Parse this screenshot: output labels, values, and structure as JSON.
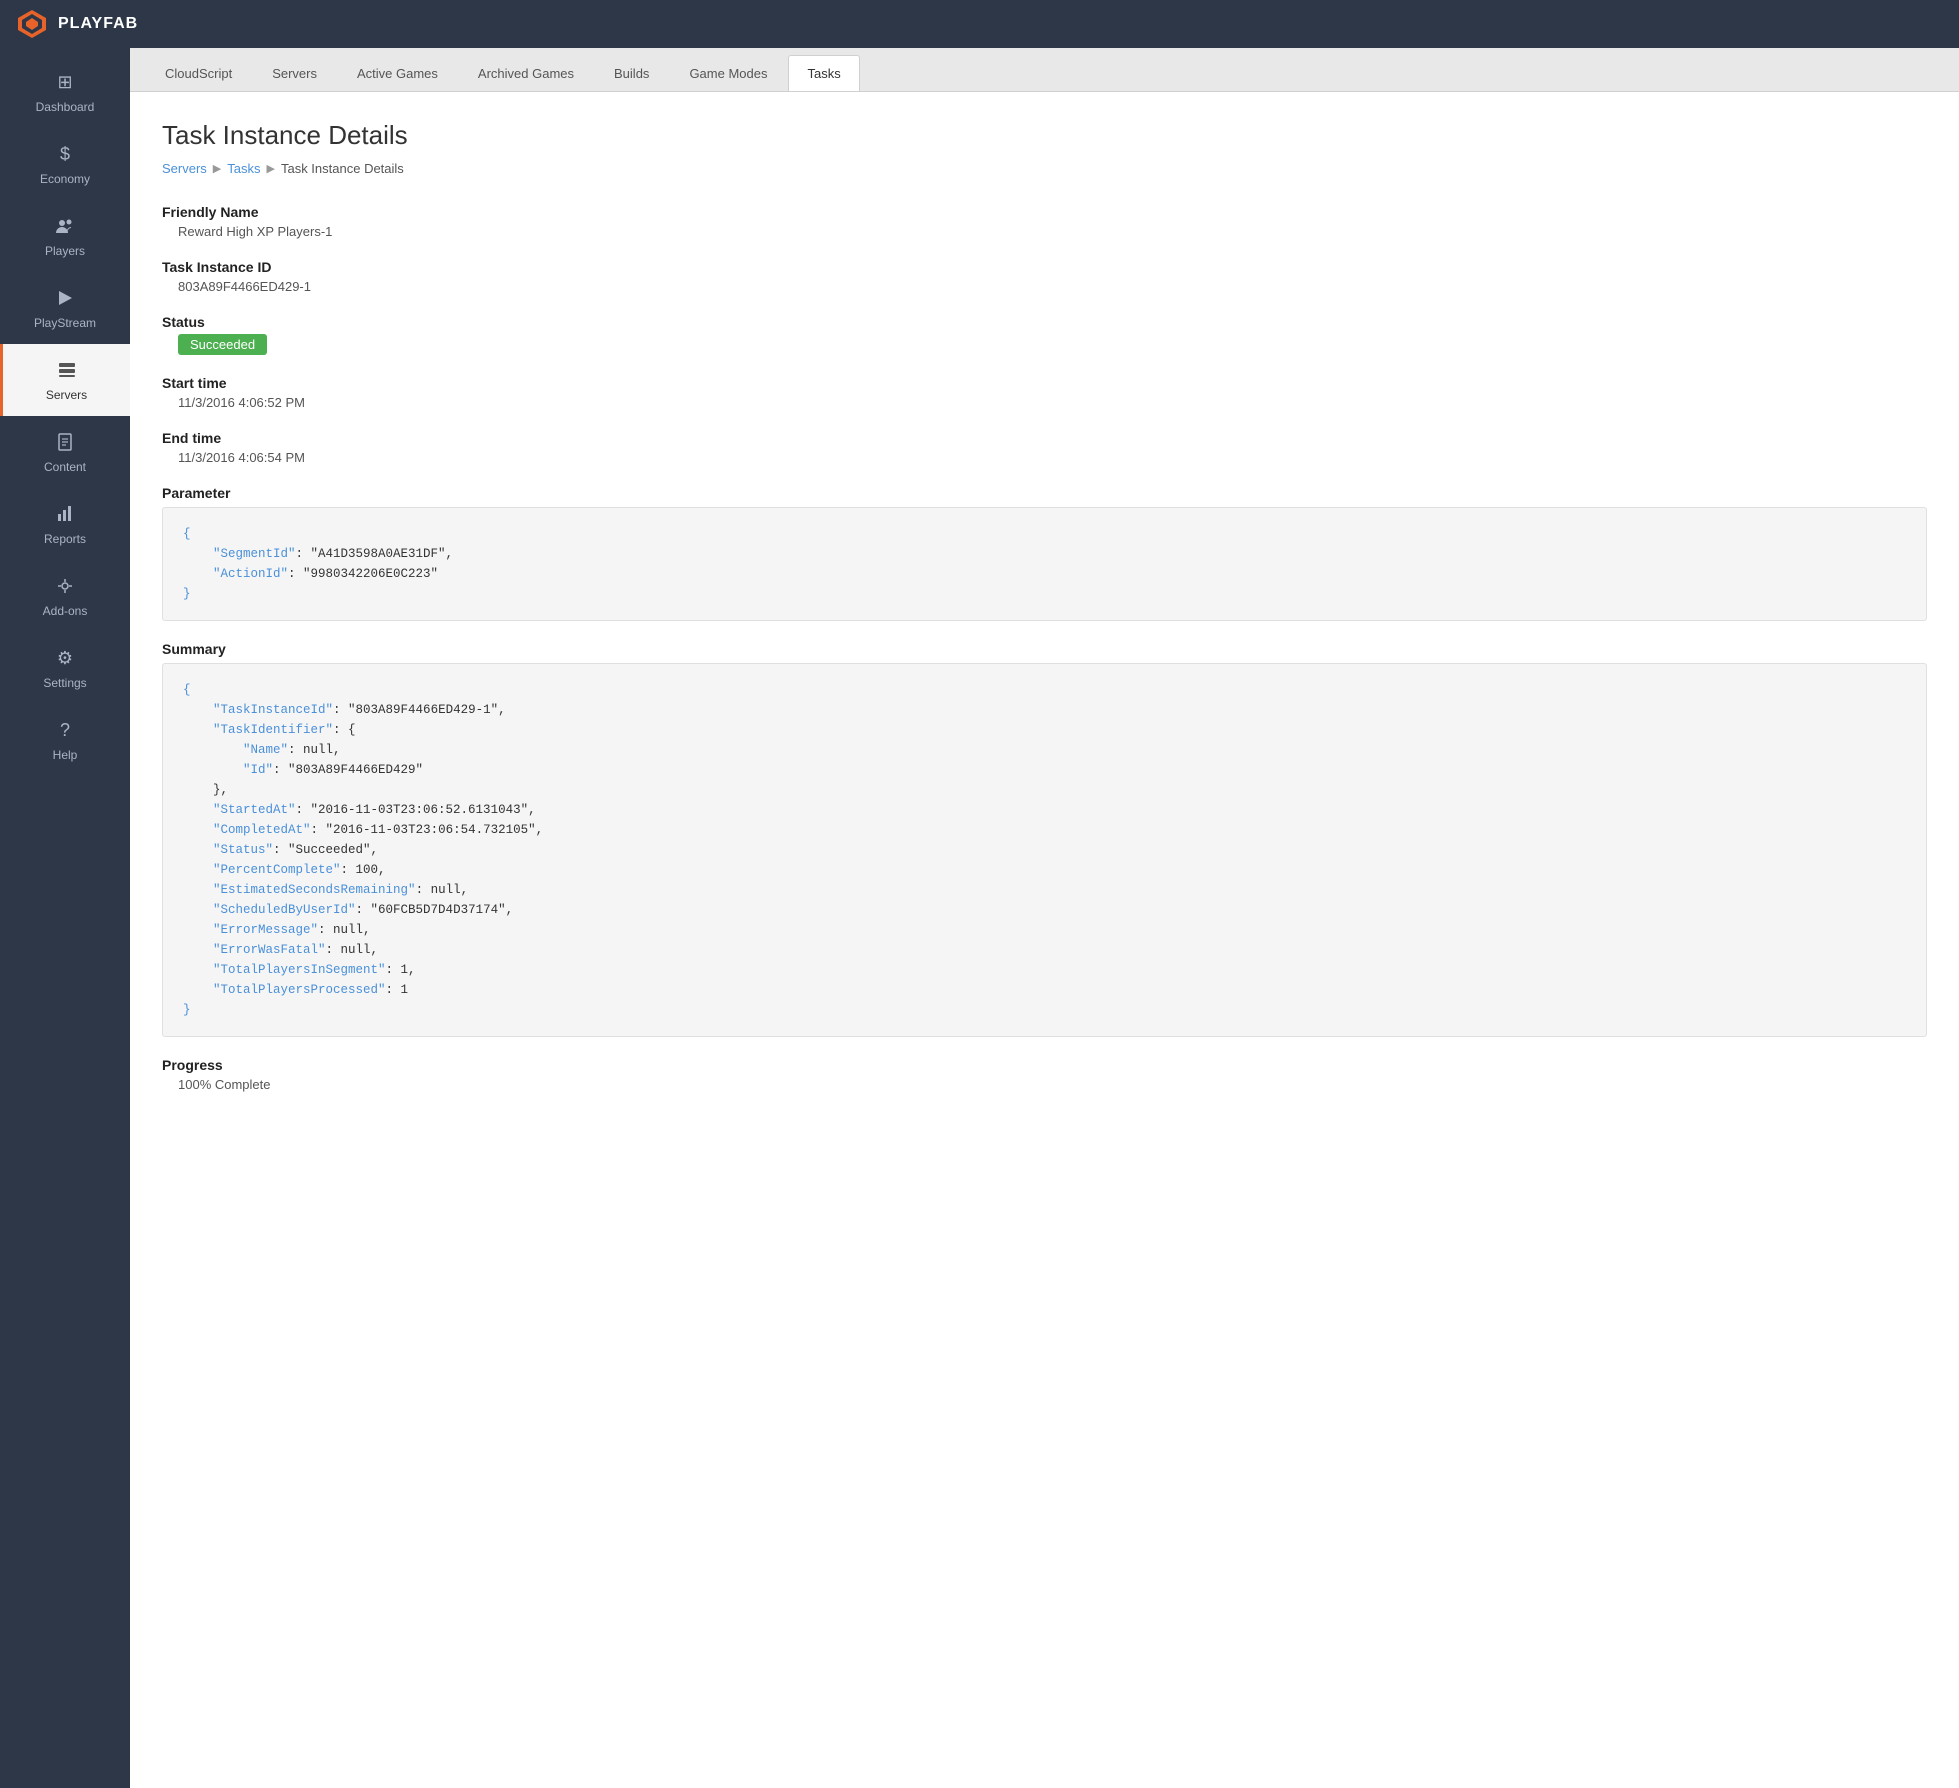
{
  "app": {
    "name": "PLAYFAB"
  },
  "sidebar": {
    "items": [
      {
        "id": "dashboard",
        "label": "Dashboard",
        "icon": "⊞",
        "active": false
      },
      {
        "id": "economy",
        "label": "Economy",
        "icon": "💲",
        "active": false
      },
      {
        "id": "players",
        "label": "Players",
        "icon": "👥",
        "active": false
      },
      {
        "id": "playstream",
        "label": "PlayStream",
        "icon": "📢",
        "active": false
      },
      {
        "id": "servers",
        "label": "Servers",
        "icon": "🖥",
        "active": true
      },
      {
        "id": "content",
        "label": "Content",
        "icon": "📄",
        "active": false
      },
      {
        "id": "reports",
        "label": "Reports",
        "icon": "📊",
        "active": false
      },
      {
        "id": "addons",
        "label": "Add-ons",
        "icon": "🔧",
        "active": false
      },
      {
        "id": "settings",
        "label": "Settings",
        "icon": "⚙",
        "active": false
      },
      {
        "id": "help",
        "label": "Help",
        "icon": "?",
        "active": false
      }
    ]
  },
  "tabs": [
    {
      "id": "cloudscript",
      "label": "CloudScript",
      "active": false
    },
    {
      "id": "servers",
      "label": "Servers",
      "active": false
    },
    {
      "id": "active-games",
      "label": "Active Games",
      "active": false
    },
    {
      "id": "archived-games",
      "label": "Archived Games",
      "active": false
    },
    {
      "id": "builds",
      "label": "Builds",
      "active": false
    },
    {
      "id": "game-modes",
      "label": "Game Modes",
      "active": false
    },
    {
      "id": "tasks",
      "label": "Tasks",
      "active": true
    }
  ],
  "page": {
    "title": "Task Instance Details",
    "breadcrumb": {
      "servers": "Servers",
      "tasks": "Tasks",
      "current": "Task Instance Details"
    },
    "friendly_name_label": "Friendly Name",
    "friendly_name_value": "Reward High XP Players-1",
    "task_instance_id_label": "Task Instance ID",
    "task_instance_id_value": "803A89F4466ED429-1",
    "status_label": "Status",
    "status_value": "Succeeded",
    "start_time_label": "Start time",
    "start_time_value": "11/3/2016 4:06:52 PM",
    "end_time_label": "End time",
    "end_time_value": "11/3/2016 4:06:54 PM",
    "parameter_label": "Parameter",
    "parameter_code": "{\n    \"SegmentId\": \"A41D3598A0AE31DF\",\n    \"ActionId\": \"9980342206E0C223\"\n}",
    "summary_label": "Summary",
    "summary_code": "{\n    \"TaskInstanceId\": \"803A89F4466ED429-1\",\n    \"TaskIdentifier\": {\n        \"Name\": null,\n        \"Id\": \"803A89F4466ED429\"\n    },\n    \"StartedAt\": \"2016-11-03T23:06:52.6131043\",\n    \"CompletedAt\": \"2016-11-03T23:06:54.732105\",\n    \"Status\": \"Succeeded\",\n    \"PercentComplete\": 100,\n    \"EstimatedSecondsRemaining\": null,\n    \"ScheduledByUserId\": \"60FCB5D7D4D37174\",\n    \"ErrorMessage\": null,\n    \"ErrorWasFatal\": null,\n    \"TotalPlayersInSegment\": 1,\n    \"TotalPlayersProcessed\": 1\n}",
    "progress_label": "Progress",
    "progress_value": "100% Complete"
  }
}
